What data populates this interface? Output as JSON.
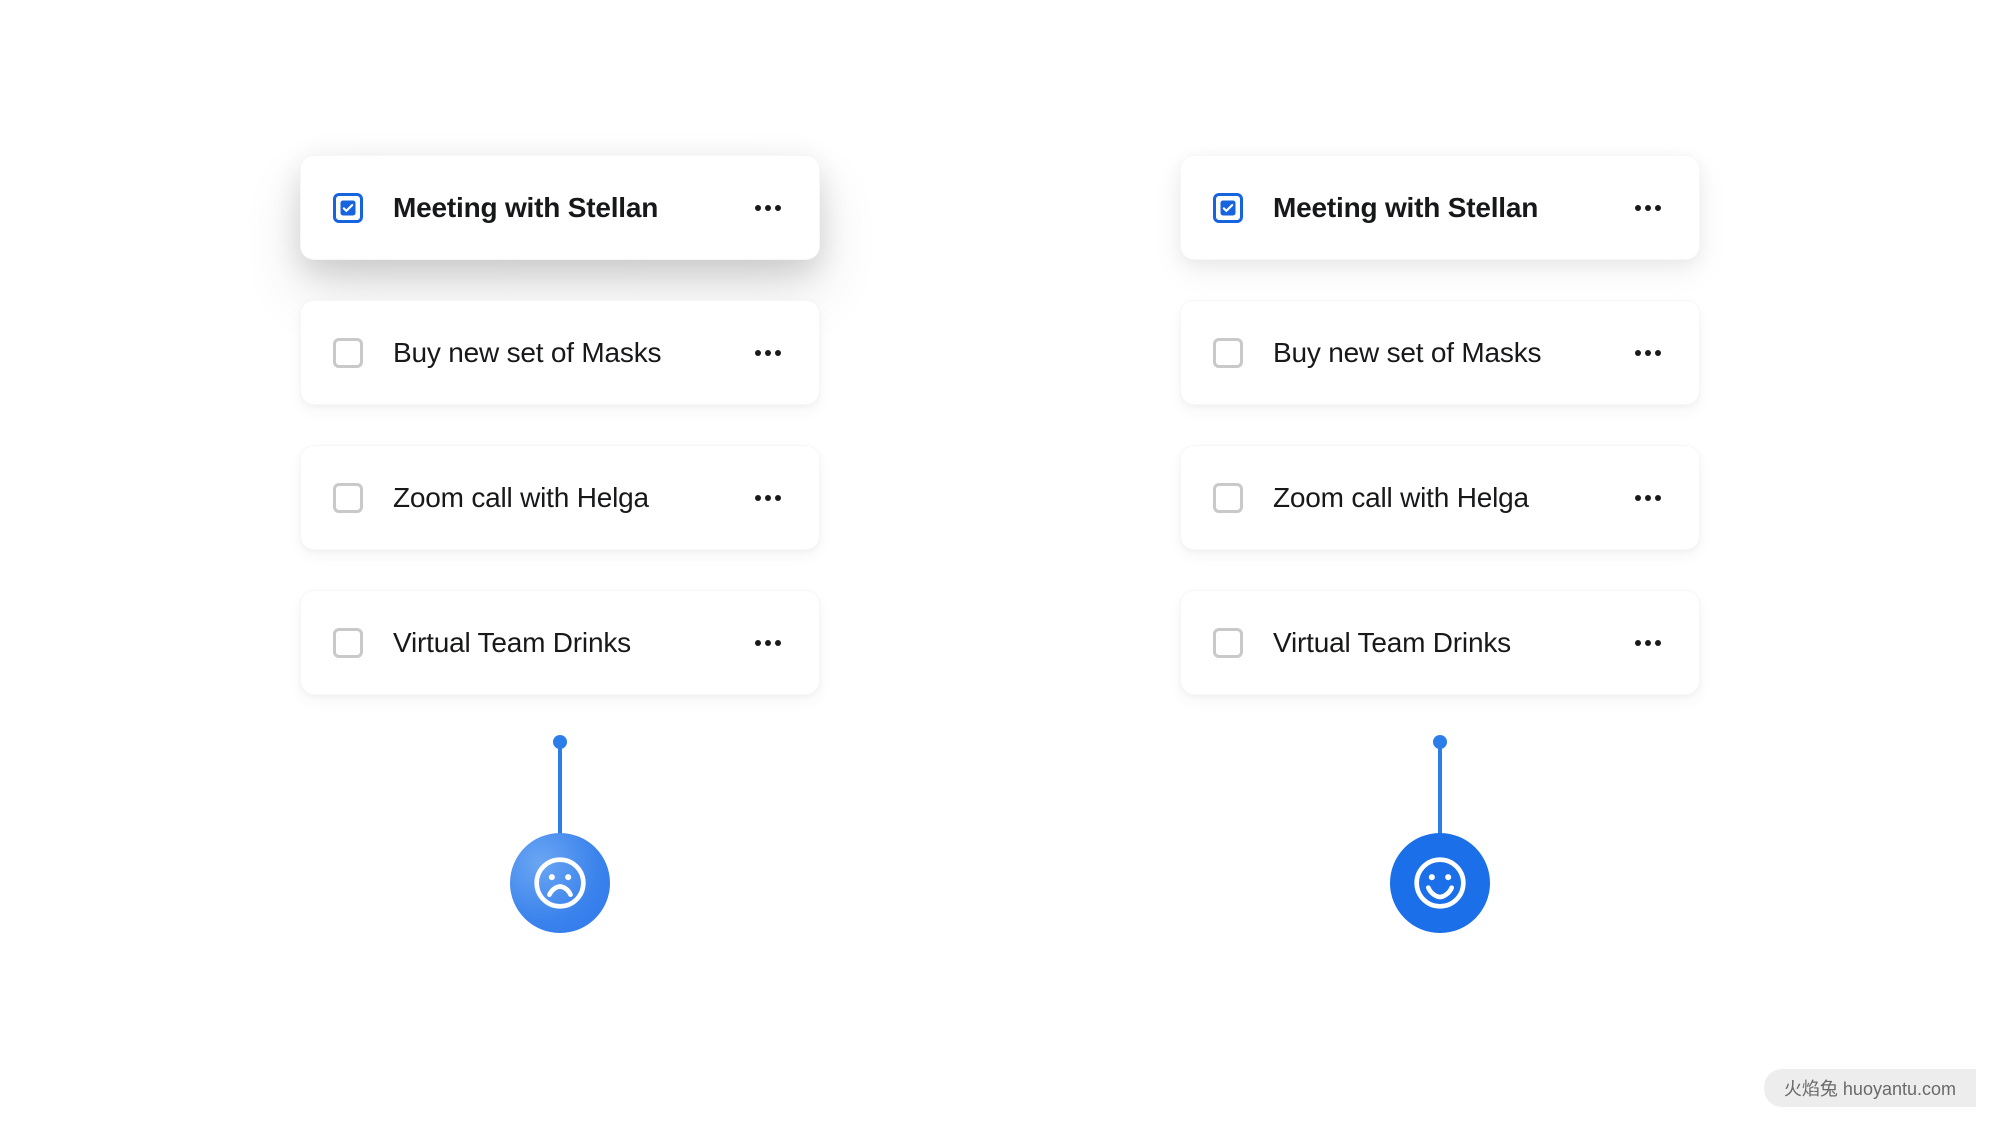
{
  "left": {
    "tasks": [
      {
        "label": "Meeting with Stellan",
        "checked": true,
        "emphasis": true,
        "elevated": "strong"
      },
      {
        "label": "Buy new set of Masks",
        "checked": false,
        "emphasis": false,
        "elevated": "none"
      },
      {
        "label": "Zoom call with Helga",
        "checked": false,
        "emphasis": false,
        "elevated": "none"
      },
      {
        "label": "Virtual Team Drinks",
        "checked": false,
        "emphasis": false,
        "elevated": "none"
      }
    ],
    "sentiment": "sad"
  },
  "right": {
    "tasks": [
      {
        "label": "Meeting with Stellan",
        "checked": true,
        "emphasis": true,
        "elevated": "soft"
      },
      {
        "label": "Buy new set of Masks",
        "checked": false,
        "emphasis": false,
        "elevated": "none"
      },
      {
        "label": "Zoom call with Helga",
        "checked": false,
        "emphasis": false,
        "elevated": "none"
      },
      {
        "label": "Virtual Team Drinks",
        "checked": false,
        "emphasis": false,
        "elevated": "none"
      }
    ],
    "sentiment": "happy"
  },
  "colors": {
    "accent": "#1664e0",
    "indicator": "#2b7de9"
  },
  "watermark": "火焰兔 huoyantu.com"
}
